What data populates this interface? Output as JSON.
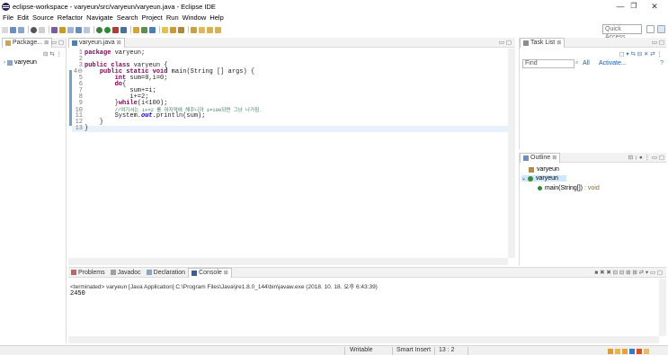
{
  "window": {
    "title": "eclipse-workspace - varyeun/src/varyeun/varyeun.java - Eclipse IDE",
    "minimize": "—",
    "maximize": "❐",
    "close": "✕"
  },
  "menu": [
    "File",
    "Edit",
    "Source",
    "Refactor",
    "Navigate",
    "Search",
    "Project",
    "Run",
    "Window",
    "Help"
  ],
  "quick_access": {
    "placeholder": "Quick Access"
  },
  "package_explorer": {
    "tab_label": "Package...",
    "close": "⊠",
    "project": "varyeun"
  },
  "editor": {
    "tab_label": "varyeun.java",
    "close": "⊠",
    "lines": [
      {
        "n": "1",
        "segments": [
          {
            "t": "package",
            "c": "kw"
          },
          {
            "t": " varyeun;",
            "c": ""
          }
        ]
      },
      {
        "n": "2",
        "segments": []
      },
      {
        "n": "3",
        "segments": [
          {
            "t": "public",
            "c": "kw"
          },
          {
            "t": " ",
            "c": ""
          },
          {
            "t": "class",
            "c": "kw"
          },
          {
            "t": " varyeun {",
            "c": ""
          }
        ]
      },
      {
        "n": "4⊖",
        "segments": [
          {
            "t": "    ",
            "c": ""
          },
          {
            "t": "public",
            "c": "kw"
          },
          {
            "t": " ",
            "c": ""
          },
          {
            "t": "static",
            "c": "kw"
          },
          {
            "t": " ",
            "c": ""
          },
          {
            "t": "void",
            "c": "kw"
          },
          {
            "t": " main(String [] args) {",
            "c": ""
          }
        ]
      },
      {
        "n": "5",
        "segments": [
          {
            "t": "        ",
            "c": ""
          },
          {
            "t": "int",
            "c": "kw"
          },
          {
            "t": " sum=0,i=0;",
            "c": ""
          }
        ]
      },
      {
        "n": "6",
        "segments": [
          {
            "t": "        ",
            "c": ""
          },
          {
            "t": "do",
            "c": "kw"
          },
          {
            "t": "{",
            "c": ""
          }
        ]
      },
      {
        "n": "7",
        "segments": [
          {
            "t": "            sum+=i;",
            "c": ""
          }
        ]
      },
      {
        "n": "8",
        "segments": [
          {
            "t": "            i+=2;",
            "c": ""
          }
        ]
      },
      {
        "n": "9",
        "segments": [
          {
            "t": "        }",
            "c": ""
          },
          {
            "t": "while",
            "c": "kw"
          },
          {
            "t": "(i<100);",
            "c": ""
          }
        ]
      },
      {
        "n": "10",
        "segments": [
          {
            "t": "        ",
            "c": ""
          },
          {
            "t": "//여기서는 i+=2 를 마지막에 해주니까 i=100되면 그냥 나가짐.",
            "c": "cm"
          }
        ]
      },
      {
        "n": "11",
        "segments": [
          {
            "t": "        System.",
            "c": ""
          },
          {
            "t": "out",
            "c": "fld"
          },
          {
            "t": ".println(sum);",
            "c": ""
          }
        ]
      },
      {
        "n": "12",
        "segments": [
          {
            "t": "    }",
            "c": ""
          }
        ]
      },
      {
        "n": "13",
        "segments": [
          {
            "t": "}",
            "c": ""
          }
        ]
      }
    ]
  },
  "task_list": {
    "tab_label": "Task List",
    "close": "⊠",
    "find_placeholder": "Find",
    "all": "All",
    "activate": "Activate..."
  },
  "outline": {
    "tab_label": "Outline",
    "close": "⊠",
    "package": "varyeun",
    "class": "varyeun",
    "method": "main(String[])",
    "method_type": ": void"
  },
  "bottom_tabs": [
    {
      "label": "Problems",
      "active": false
    },
    {
      "label": "Javadoc",
      "active": false
    },
    {
      "label": "Declaration",
      "active": false
    },
    {
      "label": "Console",
      "active": true
    }
  ],
  "console": {
    "status": "<terminated> varyeun [Java Application] C:\\Program Files\\Java\\jre1.8.0_144\\bin\\javaw.exe (2018. 10. 18. 오후 6:43:39)",
    "output": "2450"
  },
  "status_bar": {
    "writable": "Writable",
    "insert_mode": "Smart Insert",
    "position": "13 : 2"
  },
  "colors": {
    "keyword": "#7f0055",
    "comment": "#3f7f5f",
    "field": "#0000c0",
    "current_line": "#e8f2fe",
    "link": "#0b5fb5"
  }
}
